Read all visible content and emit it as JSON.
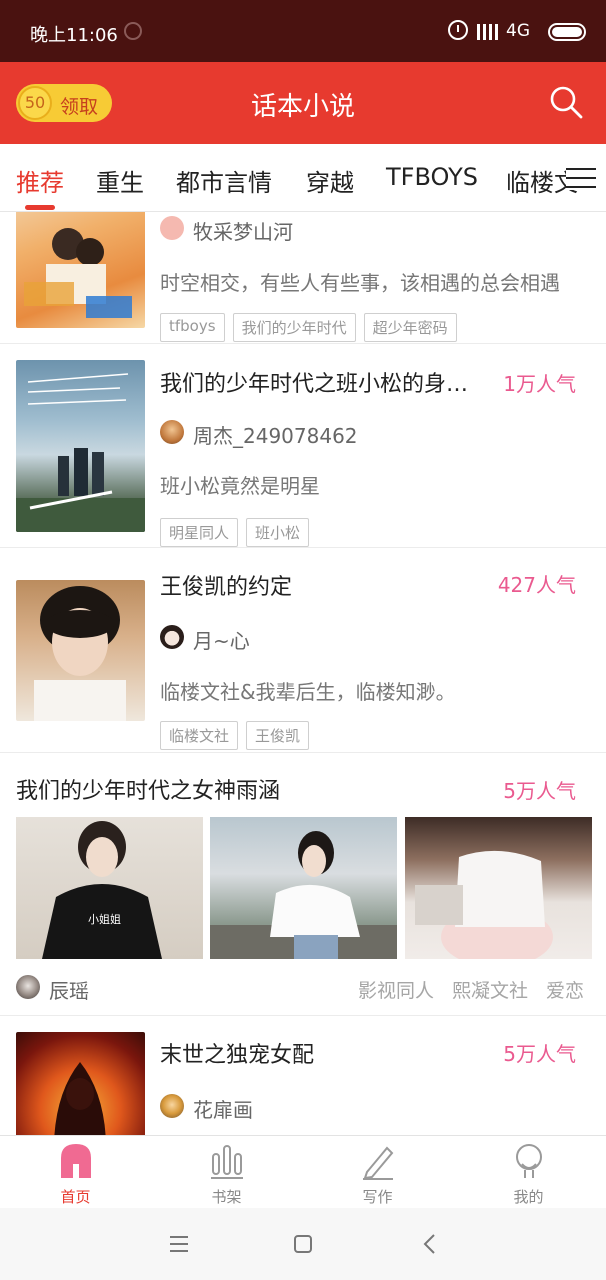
{
  "status_bar": {
    "time": "晚上11:06",
    "network": "4G"
  },
  "header": {
    "coin_amount": "50",
    "claim_label": "领取",
    "title": "话本小说",
    "search_icon": "search-icon"
  },
  "tabs": [
    {
      "label": "推荐",
      "active": true
    },
    {
      "label": "重生"
    },
    {
      "label": "都市言情"
    },
    {
      "label": "穿越"
    },
    {
      "label": "TFBOYS"
    },
    {
      "label": "临楼文"
    }
  ],
  "feed": [
    {
      "title": "",
      "popularity": "",
      "author": "牧采梦山河",
      "description": "时空相交，有些人有些事，该相遇的总会相遇",
      "tags": [
        "tfboys",
        "我们的少年时代",
        "超少年密码"
      ]
    },
    {
      "title": "我们的少年时代之班小松的身世之谜",
      "popularity": "1万人气",
      "author": "周杰_249078462",
      "description": "班小松竟然是明星",
      "tags": [
        "明星同人",
        "班小松"
      ]
    },
    {
      "title": "王俊凯的约定",
      "popularity": "427人气",
      "author": "月~心",
      "description": "临楼文社&我辈后生，临楼知渺。",
      "tags": [
        "临楼文社",
        "王俊凯"
      ]
    }
  ],
  "feature": {
    "title": "我们的少年时代之女神雨涵",
    "popularity": "5万人气",
    "author": "辰瑶",
    "tags": [
      "影视同人",
      "熙凝文社",
      "爱恋"
    ],
    "photo_shirt_text": "小姐姐"
  },
  "last_card": {
    "title": "末世之独宠女配",
    "popularity": "5万人气",
    "author": "花扉画"
  },
  "bottom_nav": [
    {
      "label": "首页",
      "icon": "home-icon",
      "active": true
    },
    {
      "label": "书架",
      "icon": "bookshelf-icon"
    },
    {
      "label": "写作",
      "icon": "pencil-icon"
    },
    {
      "label": "我的",
      "icon": "profile-icon"
    }
  ],
  "colors": {
    "accent": "#e73a2f",
    "popularity": "#ea5a8f",
    "status_bar": "#4a1210",
    "coin": "#f7cb35"
  }
}
